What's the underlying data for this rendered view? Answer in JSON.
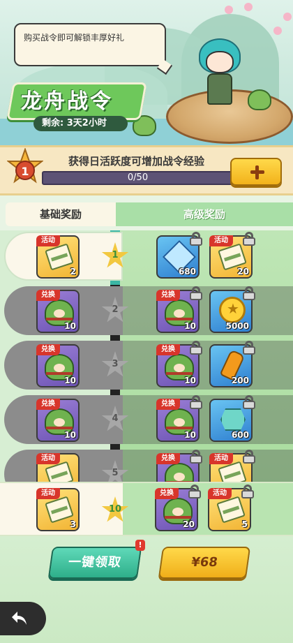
{
  "header": {
    "speech": "购买战令即可解锁丰厚好礼",
    "title": "龙舟战令",
    "remaining": "剩余: 3天2小时"
  },
  "xp": {
    "level": "1",
    "hint": "获得日活跃度可增加战令经验",
    "progress_text": "0/50",
    "progress_fraction": 0.0
  },
  "tabs": {
    "basic": "基础奖励",
    "advanced": "高级奖励"
  },
  "rows": [
    {
      "level": "1",
      "state": "unlocked",
      "basic": {
        "tag": "活动",
        "icon": "ticket-icon",
        "count": "2"
      },
      "adv": [
        {
          "tag": "",
          "icon": "diamond-icon",
          "count": "680"
        },
        {
          "tag": "活动",
          "icon": "ticket-icon",
          "count": "20"
        }
      ]
    },
    {
      "level": "2",
      "state": "locked",
      "basic": {
        "tag": "兑换",
        "icon": "zongzi-icon",
        "count": "10"
      },
      "adv": [
        {
          "tag": "兑换",
          "icon": "zongzi-icon",
          "count": "10"
        },
        {
          "tag": "",
          "icon": "gold-coin-icon",
          "count": "5000"
        }
      ]
    },
    {
      "level": "3",
      "state": "locked",
      "basic": {
        "tag": "兑换",
        "icon": "zongzi-icon",
        "count": "10"
      },
      "adv": [
        {
          "tag": "兑换",
          "icon": "zongzi-icon",
          "count": "10"
        },
        {
          "tag": "",
          "icon": "potion-bottle-icon",
          "count": "200"
        }
      ]
    },
    {
      "level": "4",
      "state": "locked",
      "basic": {
        "tag": "兑换",
        "icon": "zongzi-icon",
        "count": "10"
      },
      "adv": [
        {
          "tag": "兑换",
          "icon": "zongzi-icon",
          "count": "10"
        },
        {
          "tag": "",
          "icon": "crystal-ore-icon",
          "count": "600"
        }
      ]
    },
    {
      "level": "5",
      "state": "locked",
      "basic": {
        "tag": "活动",
        "icon": "ticket-icon",
        "count": ""
      },
      "adv": [
        {
          "tag": "兑换",
          "icon": "zongzi-icon",
          "count": ""
        },
        {
          "tag": "活动",
          "icon": "ticket-icon",
          "count": ""
        }
      ]
    }
  ],
  "final_row": {
    "level": "10",
    "basic": {
      "tag": "活动",
      "icon": "ticket-icon",
      "count": "3"
    },
    "adv": [
      {
        "tag": "兑换",
        "icon": "zongzi-icon",
        "count": "20"
      },
      {
        "tag": "活动",
        "icon": "ticket-icon",
        "count": "5"
      }
    ]
  },
  "buttons": {
    "claim_all": "一键领取",
    "claim_badge": "!",
    "buy": "¥68"
  },
  "colors": {
    "accent_green": "#6ec85b",
    "claim_teal": "#2eaf8a",
    "buy_gold": "#f0ae19",
    "tag_red": "#d8352b"
  }
}
